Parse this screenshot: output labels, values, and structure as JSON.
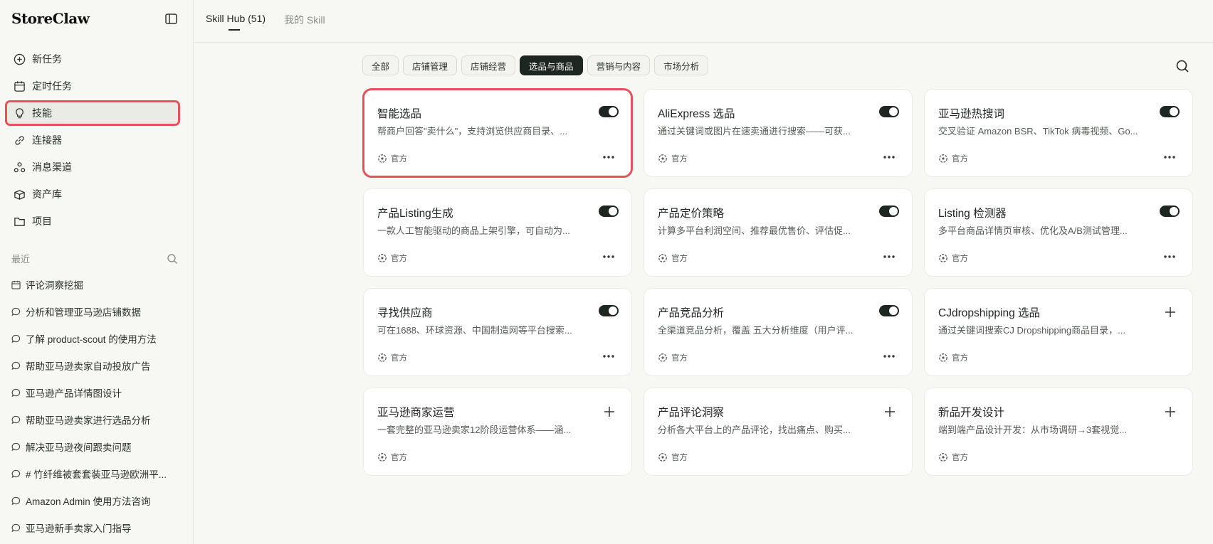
{
  "app": {
    "brand": "StoreClaw"
  },
  "sidebar": {
    "nav": [
      {
        "label": "新任务",
        "icon": "plus-circle-icon"
      },
      {
        "label": "定时任务",
        "icon": "calendar-icon"
      },
      {
        "label": "技能",
        "icon": "lightbulb-icon",
        "active": true
      },
      {
        "label": "连接器",
        "icon": "link-icon"
      },
      {
        "label": "消息渠道",
        "icon": "channels-icon"
      },
      {
        "label": "资产库",
        "icon": "box-icon"
      },
      {
        "label": "项目",
        "icon": "folder-icon"
      }
    ],
    "recent_label": "最近",
    "recent": [
      {
        "label": "评论洞察挖掘",
        "icon": "calendar-icon"
      },
      {
        "label": "分析和管理亚马逊店铺数据",
        "icon": "chat-icon"
      },
      {
        "label": "了解 product-scout 的使用方法",
        "icon": "chat-icon"
      },
      {
        "label": "帮助亚马逊卖家自动投放广告",
        "icon": "chat-icon"
      },
      {
        "label": "亚马逊产品详情图设计",
        "icon": "chat-icon"
      },
      {
        "label": "帮助亚马逊卖家进行选品分析",
        "icon": "chat-icon"
      },
      {
        "label": "解决亚马逊夜间跟卖问题",
        "icon": "chat-icon"
      },
      {
        "label": "# 竹纤维被套套装亚马逊欧洲平...",
        "icon": "chat-icon"
      },
      {
        "label": "Amazon Admin 使用方法咨询",
        "icon": "chat-icon"
      },
      {
        "label": "亚马逊新手卖家入门指导",
        "icon": "chat-icon"
      }
    ]
  },
  "topbar": {
    "tabs": [
      {
        "label": "Skill Hub (51)",
        "active": true
      },
      {
        "label": "我的 Skill",
        "active": false
      }
    ]
  },
  "filters": [
    {
      "label": "全部"
    },
    {
      "label": "店铺管理"
    },
    {
      "label": "店铺经营"
    },
    {
      "label": "选品与商品",
      "active": true
    },
    {
      "label": "营销与内容"
    },
    {
      "label": "市场分析"
    }
  ],
  "badge_label": "官方",
  "skills": [
    {
      "title": "智能选品",
      "desc": "帮商户回答\"卖什么\"，支持浏览供应商目录、...",
      "enabled": true,
      "highlight": true
    },
    {
      "title": "AliExpress 选品",
      "desc": "通过关键词或图片在速卖通进行搜索——可获...",
      "enabled": true
    },
    {
      "title": "亚马逊热搜词",
      "desc": "交叉验证 Amazon BSR、TikTok 病毒视频、Go...",
      "enabled": true
    },
    {
      "title": "产品Listing生成",
      "desc": "一款人工智能驱动的商品上架引擎，可自动为...",
      "enabled": true
    },
    {
      "title": "产品定价策略",
      "desc": "计算多平台利润空间、推荐最优售价、评估促...",
      "enabled": true
    },
    {
      "title": "Listing 检测器",
      "desc": "多平台商品详情页审核、优化及A/B测试管理...",
      "enabled": true
    },
    {
      "title": "寻找供应商",
      "desc": "可在1688、环球资源、中国制造网等平台搜索...",
      "enabled": true
    },
    {
      "title": "产品竞品分析",
      "desc": "全渠道竞品分析，覆盖 五大分析维度（用户评...",
      "enabled": true
    },
    {
      "title": "CJdropshipping 选品",
      "desc": "通过关键词搜索CJ Dropshipping商品目录，...",
      "enabled": false
    },
    {
      "title": "亚马逊商家运营",
      "desc": "一套完整的亚马逊卖家12阶段运营体系——涵...",
      "enabled": false
    },
    {
      "title": "产品评论洞察",
      "desc": "分析各大平台上的产品评论，找出痛点、购买...",
      "enabled": false
    },
    {
      "title": "新品开发设计",
      "desc": "端到端产品设计开发：从市场调研→3套视觉...",
      "enabled": false
    }
  ]
}
